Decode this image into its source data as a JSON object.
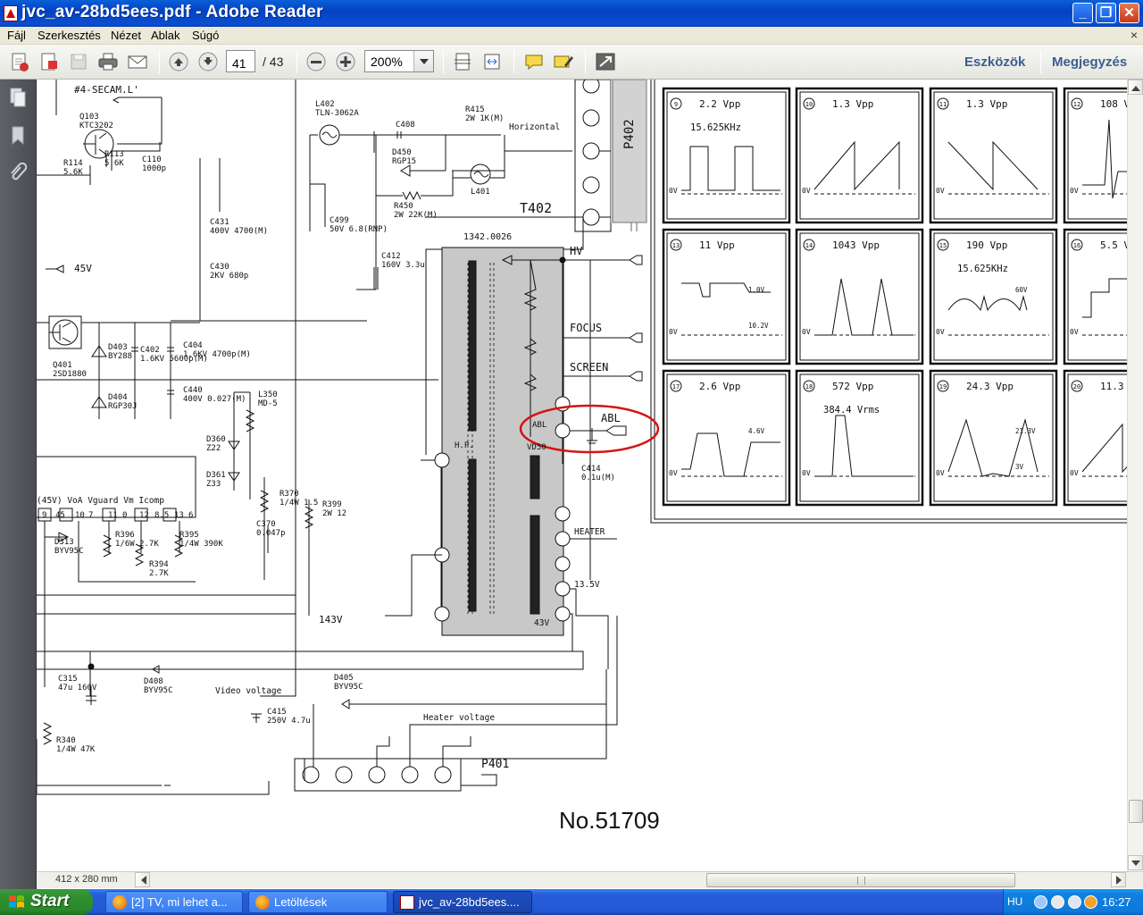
{
  "window": {
    "title": "jvc_av-28bd5ees.pdf - Adobe Reader"
  },
  "menu": [
    "Fájl",
    "Szerkesztés",
    "Nézet",
    "Ablak",
    "Súgó"
  ],
  "toolbar": {
    "page_current": "41",
    "page_total": "/ 43",
    "zoom": "200%",
    "tools_label": "Eszközök",
    "comment_label": "Megjegyzés"
  },
  "status": {
    "page_size": "412 x 280 mm"
  },
  "taskbar": {
    "start": "Start",
    "tasks": [
      "[2] TV, mi lehet a...",
      "Letöltések",
      "jvc_av-28bd5ees...."
    ],
    "lang": "HU",
    "clock": "16:27"
  },
  "schematic": {
    "ref_no": "No.51709",
    "signal_label": "#4-SECAM.L'",
    "rail_45v": "45V",
    "rail_143v": "143V",
    "fbt_name": "T402",
    "fbt_part": "1342.0026",
    "connector_p402": "P402",
    "connector_p401": "P401",
    "horizontal_label": "Horizontal",
    "video_voltage_label": "Video voltage",
    "heater_voltage_label": "Heater voltage",
    "fbt_pins": {
      "hv": "HV",
      "focus": "FOCUS",
      "screen": "SCREEN",
      "abl_out": "ABL",
      "abl_in": "ABL",
      "vd50": "VD50",
      "hp": "H.P.",
      "heater": "HEATER",
      "v13_5": "13.5V",
      "v43": "43V"
    },
    "ic_pins": {
      "header": "(45V) VoA Vguard   Vm  Icomp",
      "numbers": [
        "9",
        "45",
        "10",
        "7",
        "11",
        "0",
        "12",
        "8.5",
        "13",
        "6"
      ]
    },
    "components": [
      {
        "ref": "Q103",
        "value": "KTC3202"
      },
      {
        "ref": "R114",
        "value": "5.6K"
      },
      {
        "ref": "R113",
        "value": "5.6K"
      },
      {
        "ref": "C110",
        "value": "1000p"
      },
      {
        "ref": "L402",
        "value": "TLN-3062A"
      },
      {
        "ref": "C408",
        "value": ""
      },
      {
        "ref": "R415",
        "value": "2W 1K(M)"
      },
      {
        "ref": "D450",
        "value": "RGP15"
      },
      {
        "ref": "L401",
        "value": ""
      },
      {
        "ref": "R450",
        "value": "2W 22K(M)"
      },
      {
        "ref": "C499",
        "value": "50V 6.8(RNP)"
      },
      {
        "ref": "C431",
        "value": "400V 4700(M)"
      },
      {
        "ref": "C430",
        "value": "2KV 680p"
      },
      {
        "ref": "C412",
        "value": "160V 3.3u"
      },
      {
        "ref": "Q401",
        "value": "2SD1880"
      },
      {
        "ref": "D403",
        "value": "BY288"
      },
      {
        "ref": "C402",
        "value": "1.6KV 5600p(M)"
      },
      {
        "ref": "C404",
        "value": "1.6KV 4700p(M)"
      },
      {
        "ref": "C440",
        "value": "400V 0.027(M)"
      },
      {
        "ref": "D404",
        "value": "RGP30J"
      },
      {
        "ref": "D360",
        "value": "Z22"
      },
      {
        "ref": "D361",
        "value": "Z33"
      },
      {
        "ref": "L350",
        "value": "MD-5"
      },
      {
        "ref": "R370",
        "value": "1/4W 1.5"
      },
      {
        "ref": "C370",
        "value": "0.047p"
      },
      {
        "ref": "R399",
        "value": "2W 12"
      },
      {
        "ref": "D313",
        "value": "BYV95C"
      },
      {
        "ref": "R396",
        "value": "1/6W 2.7K"
      },
      {
        "ref": "R394",
        "value": "2.7K"
      },
      {
        "ref": "R395",
        "value": "1/4W 390K"
      },
      {
        "ref": "C414",
        "value": "0.1u(M)"
      },
      {
        "ref": "C315",
        "value": "47u 160V"
      },
      {
        "ref": "D408",
        "value": "BYV95C"
      },
      {
        "ref": "D405",
        "value": "BYV95C"
      },
      {
        "ref": "C415",
        "value": "250V 4.7u"
      },
      {
        "ref": "R340",
        "value": "1/4W 47K"
      }
    ],
    "waveforms": [
      {
        "num": "9",
        "vpp": "2.2 Vpp",
        "note": "15.625KHz",
        "kind": "square"
      },
      {
        "num": "10",
        "vpp": "1.3 Vpp",
        "note": "",
        "kind": "ramp-up"
      },
      {
        "num": "11",
        "vpp": "1.3 Vpp",
        "note": "",
        "kind": "ramp-down"
      },
      {
        "num": "12",
        "vpp": "108 V",
        "note": "",
        "kind": "spike"
      },
      {
        "num": "13",
        "vpp": "11 Vpp",
        "note": "",
        "kind": "hsync",
        "labels": [
          "1.0V",
          "10.2V"
        ]
      },
      {
        "num": "14",
        "vpp": "1043 Vpp",
        "note": "",
        "kind": "flyback"
      },
      {
        "num": "15",
        "vpp": "190 Vpp",
        "note": "15.625KHz",
        "kind": "arcs",
        "labels": [
          "60V"
        ]
      },
      {
        "num": "16",
        "vpp": "5.5 V",
        "note": "",
        "kind": "steps"
      },
      {
        "num": "17",
        "vpp": "2.6 Vpp",
        "note": "",
        "kind": "video",
        "labels": [
          "4.6V"
        ]
      },
      {
        "num": "18",
        "vpp": "572 Vpp",
        "note": "384.4 Vrms",
        "kind": "pulse"
      },
      {
        "num": "19",
        "vpp": "24.3 Vpp",
        "note": "",
        "kind": "triangle",
        "labels": [
          "21.3V",
          "3V"
        ]
      },
      {
        "num": "20",
        "vpp": "11.3",
        "note": "",
        "kind": "ramp-up"
      }
    ],
    "zero_label": "0V"
  }
}
